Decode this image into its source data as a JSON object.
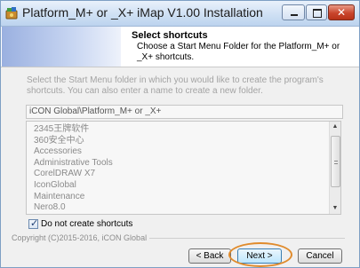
{
  "window": {
    "title": "Platform_M+ or _X+ iMap V1.00 Installation",
    "close_glyph": "✕"
  },
  "header": {
    "title": "Select shortcuts",
    "description": "Choose a Start Menu Folder for the Platform_M+ or _X+ shortcuts."
  },
  "intro_text": "Select the Start Menu folder in which you would like to create the program's shortcuts. You can also enter a name to create a new folder.",
  "folder_input": {
    "value": "iCON Global\\Platform_M+ or _X+"
  },
  "folder_list": {
    "items": [
      "2345王牌软件",
      "360安全中心",
      "Accessories",
      "Administrative Tools",
      "CorelDRAW X7",
      "IconGlobal",
      "Maintenance",
      "Nero8.0"
    ],
    "scroll_up_glyph": "▲",
    "scroll_down_glyph": "▼"
  },
  "checkbox": {
    "label": "Do not create shortcuts",
    "checked": true,
    "mark": "✓"
  },
  "footer": {
    "copyright": "Copyright (C)2015-2016, iCON Global"
  },
  "buttons": {
    "back": "< Back",
    "next": "Next >",
    "cancel": "Cancel"
  },
  "colors": {
    "highlight_ring": "#e08b2c",
    "titlebar": "#cfe0f4",
    "close_button": "#c9452c"
  }
}
